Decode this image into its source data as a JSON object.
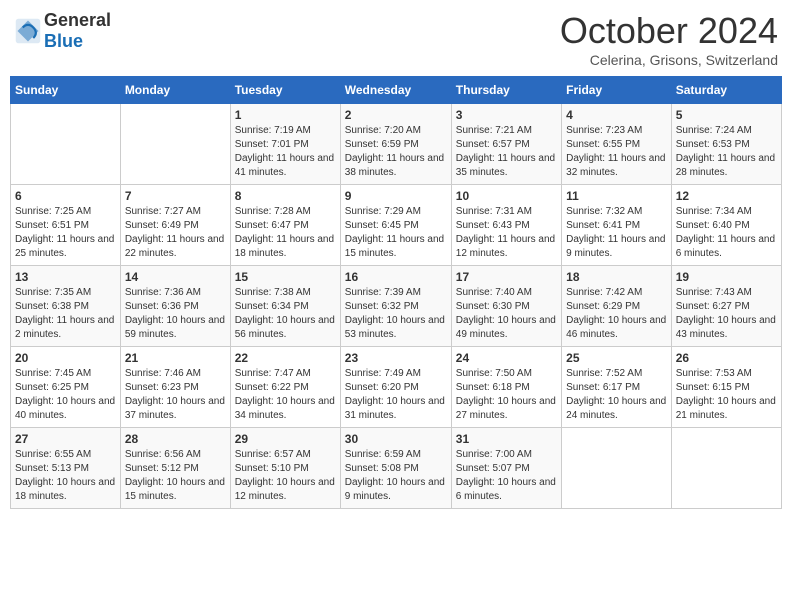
{
  "header": {
    "logo_general": "General",
    "logo_blue": "Blue",
    "month": "October 2024",
    "location": "Celerina, Grisons, Switzerland"
  },
  "days_of_week": [
    "Sunday",
    "Monday",
    "Tuesday",
    "Wednesday",
    "Thursday",
    "Friday",
    "Saturday"
  ],
  "weeks": [
    [
      {
        "day": "",
        "sunrise": "",
        "sunset": "",
        "daylight": ""
      },
      {
        "day": "",
        "sunrise": "",
        "sunset": "",
        "daylight": ""
      },
      {
        "day": "1",
        "sunrise": "Sunrise: 7:19 AM",
        "sunset": "Sunset: 7:01 PM",
        "daylight": "Daylight: 11 hours and 41 minutes."
      },
      {
        "day": "2",
        "sunrise": "Sunrise: 7:20 AM",
        "sunset": "Sunset: 6:59 PM",
        "daylight": "Daylight: 11 hours and 38 minutes."
      },
      {
        "day": "3",
        "sunrise": "Sunrise: 7:21 AM",
        "sunset": "Sunset: 6:57 PM",
        "daylight": "Daylight: 11 hours and 35 minutes."
      },
      {
        "day": "4",
        "sunrise": "Sunrise: 7:23 AM",
        "sunset": "Sunset: 6:55 PM",
        "daylight": "Daylight: 11 hours and 32 minutes."
      },
      {
        "day": "5",
        "sunrise": "Sunrise: 7:24 AM",
        "sunset": "Sunset: 6:53 PM",
        "daylight": "Daylight: 11 hours and 28 minutes."
      }
    ],
    [
      {
        "day": "6",
        "sunrise": "Sunrise: 7:25 AM",
        "sunset": "Sunset: 6:51 PM",
        "daylight": "Daylight: 11 hours and 25 minutes."
      },
      {
        "day": "7",
        "sunrise": "Sunrise: 7:27 AM",
        "sunset": "Sunset: 6:49 PM",
        "daylight": "Daylight: 11 hours and 22 minutes."
      },
      {
        "day": "8",
        "sunrise": "Sunrise: 7:28 AM",
        "sunset": "Sunset: 6:47 PM",
        "daylight": "Daylight: 11 hours and 18 minutes."
      },
      {
        "day": "9",
        "sunrise": "Sunrise: 7:29 AM",
        "sunset": "Sunset: 6:45 PM",
        "daylight": "Daylight: 11 hours and 15 minutes."
      },
      {
        "day": "10",
        "sunrise": "Sunrise: 7:31 AM",
        "sunset": "Sunset: 6:43 PM",
        "daylight": "Daylight: 11 hours and 12 minutes."
      },
      {
        "day": "11",
        "sunrise": "Sunrise: 7:32 AM",
        "sunset": "Sunset: 6:41 PM",
        "daylight": "Daylight: 11 hours and 9 minutes."
      },
      {
        "day": "12",
        "sunrise": "Sunrise: 7:34 AM",
        "sunset": "Sunset: 6:40 PM",
        "daylight": "Daylight: 11 hours and 6 minutes."
      }
    ],
    [
      {
        "day": "13",
        "sunrise": "Sunrise: 7:35 AM",
        "sunset": "Sunset: 6:38 PM",
        "daylight": "Daylight: 11 hours and 2 minutes."
      },
      {
        "day": "14",
        "sunrise": "Sunrise: 7:36 AM",
        "sunset": "Sunset: 6:36 PM",
        "daylight": "Daylight: 10 hours and 59 minutes."
      },
      {
        "day": "15",
        "sunrise": "Sunrise: 7:38 AM",
        "sunset": "Sunset: 6:34 PM",
        "daylight": "Daylight: 10 hours and 56 minutes."
      },
      {
        "day": "16",
        "sunrise": "Sunrise: 7:39 AM",
        "sunset": "Sunset: 6:32 PM",
        "daylight": "Daylight: 10 hours and 53 minutes."
      },
      {
        "day": "17",
        "sunrise": "Sunrise: 7:40 AM",
        "sunset": "Sunset: 6:30 PM",
        "daylight": "Daylight: 10 hours and 49 minutes."
      },
      {
        "day": "18",
        "sunrise": "Sunrise: 7:42 AM",
        "sunset": "Sunset: 6:29 PM",
        "daylight": "Daylight: 10 hours and 46 minutes."
      },
      {
        "day": "19",
        "sunrise": "Sunrise: 7:43 AM",
        "sunset": "Sunset: 6:27 PM",
        "daylight": "Daylight: 10 hours and 43 minutes."
      }
    ],
    [
      {
        "day": "20",
        "sunrise": "Sunrise: 7:45 AM",
        "sunset": "Sunset: 6:25 PM",
        "daylight": "Daylight: 10 hours and 40 minutes."
      },
      {
        "day": "21",
        "sunrise": "Sunrise: 7:46 AM",
        "sunset": "Sunset: 6:23 PM",
        "daylight": "Daylight: 10 hours and 37 minutes."
      },
      {
        "day": "22",
        "sunrise": "Sunrise: 7:47 AM",
        "sunset": "Sunset: 6:22 PM",
        "daylight": "Daylight: 10 hours and 34 minutes."
      },
      {
        "day": "23",
        "sunrise": "Sunrise: 7:49 AM",
        "sunset": "Sunset: 6:20 PM",
        "daylight": "Daylight: 10 hours and 31 minutes."
      },
      {
        "day": "24",
        "sunrise": "Sunrise: 7:50 AM",
        "sunset": "Sunset: 6:18 PM",
        "daylight": "Daylight: 10 hours and 27 minutes."
      },
      {
        "day": "25",
        "sunrise": "Sunrise: 7:52 AM",
        "sunset": "Sunset: 6:17 PM",
        "daylight": "Daylight: 10 hours and 24 minutes."
      },
      {
        "day": "26",
        "sunrise": "Sunrise: 7:53 AM",
        "sunset": "Sunset: 6:15 PM",
        "daylight": "Daylight: 10 hours and 21 minutes."
      }
    ],
    [
      {
        "day": "27",
        "sunrise": "Sunrise: 6:55 AM",
        "sunset": "Sunset: 5:13 PM",
        "daylight": "Daylight: 10 hours and 18 minutes."
      },
      {
        "day": "28",
        "sunrise": "Sunrise: 6:56 AM",
        "sunset": "Sunset: 5:12 PM",
        "daylight": "Daylight: 10 hours and 15 minutes."
      },
      {
        "day": "29",
        "sunrise": "Sunrise: 6:57 AM",
        "sunset": "Sunset: 5:10 PM",
        "daylight": "Daylight: 10 hours and 12 minutes."
      },
      {
        "day": "30",
        "sunrise": "Sunrise: 6:59 AM",
        "sunset": "Sunset: 5:08 PM",
        "daylight": "Daylight: 10 hours and 9 minutes."
      },
      {
        "day": "31",
        "sunrise": "Sunrise: 7:00 AM",
        "sunset": "Sunset: 5:07 PM",
        "daylight": "Daylight: 10 hours and 6 minutes."
      },
      {
        "day": "",
        "sunrise": "",
        "sunset": "",
        "daylight": ""
      },
      {
        "day": "",
        "sunrise": "",
        "sunset": "",
        "daylight": ""
      }
    ]
  ]
}
